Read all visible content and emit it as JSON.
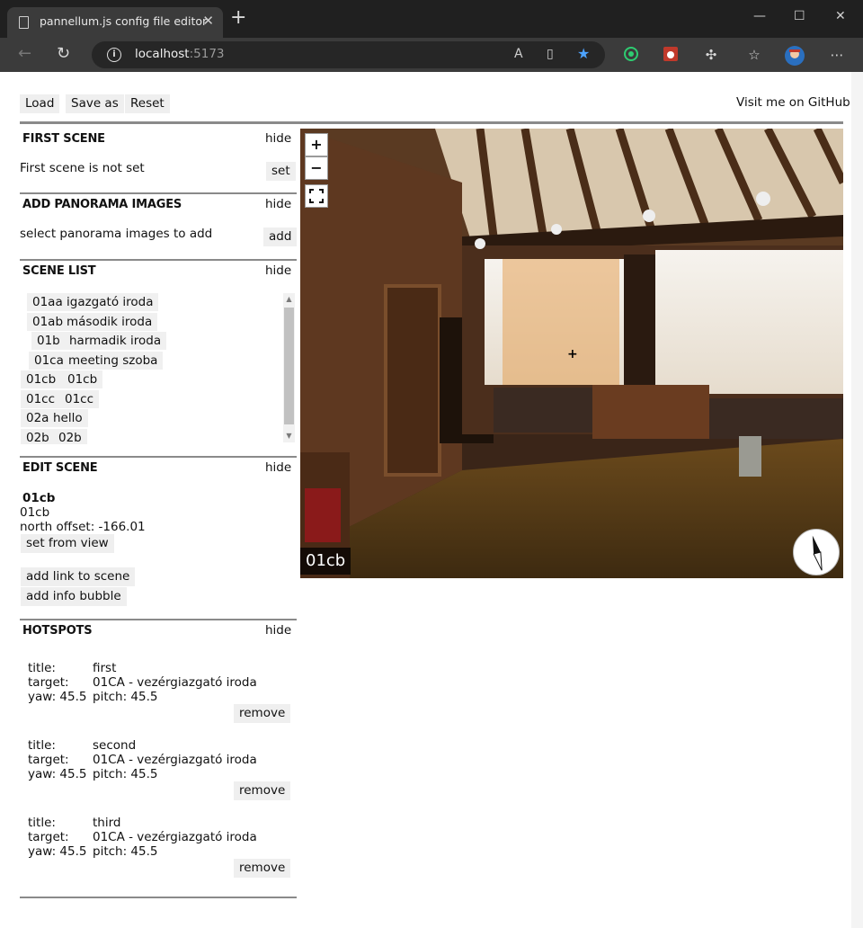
{
  "browser": {
    "tab_title": "pannellum.js config file editor",
    "url_host": "localhost",
    "url_port": ":5173"
  },
  "toolbar": {
    "load_label": "Load",
    "save_label": "Save as",
    "reset_label": "Reset",
    "github_label": "Visit me on GitHub"
  },
  "first_scene": {
    "title": "FIRST SCENE",
    "hide_label": "hide",
    "status": "First scene is not set",
    "set_label": "set"
  },
  "add_images": {
    "title": "ADD PANORAMA IMAGES",
    "hide_label": "hide",
    "prompt": "select panorama images to add",
    "add_label": "add"
  },
  "scene_list": {
    "title": "SCENE LIST",
    "hide_label": "hide",
    "items": [
      {
        "id": "01aa",
        "name": "igazgató iroda"
      },
      {
        "id": "01ab",
        "name": "második iroda"
      },
      {
        "id": "01b",
        "name": "harmadik iroda"
      },
      {
        "id": "01ca",
        "name": "meeting szoba"
      },
      {
        "id": "01cb",
        "name": "01cb"
      },
      {
        "id": "01cc",
        "name": "01cc"
      },
      {
        "id": "02a",
        "name": "hello"
      },
      {
        "id": "02b",
        "name": "02b"
      }
    ]
  },
  "edit_scene": {
    "title": "EDIT SCENE",
    "hide_label": "hide",
    "scene_id": "01cb",
    "scene_name": "01cb",
    "north_offset": "north offset: -166.01",
    "set_from_view_label": "set from view",
    "add_link_label": "add link to scene",
    "add_info_label": "add info bubble"
  },
  "hotspots": {
    "title": "HOTSPOTS",
    "hide_label": "hide",
    "label_title": "title:",
    "label_target": "target:",
    "remove_label": "remove",
    "items": [
      {
        "title": "first",
        "target": "01CA - vezérgiazgató iroda",
        "yaw": "yaw: 45.5",
        "pitch": "pitch: 45.5"
      },
      {
        "title": "second",
        "target": "01CA - vezérgiazgató iroda",
        "yaw": "yaw: 45.5",
        "pitch": "pitch: 45.5"
      },
      {
        "title": "third",
        "target": "01CA - vezérgiazgató iroda",
        "yaw": "yaw: 45.5",
        "pitch": "pitch: 45.5"
      }
    ]
  },
  "viewer": {
    "zoom_in": "+",
    "zoom_out": "−",
    "scene_label": "01cb"
  },
  "colors": {
    "rule": "#8a8a8a",
    "button_bg": "#efefef",
    "star_accent": "#4da3ff"
  }
}
